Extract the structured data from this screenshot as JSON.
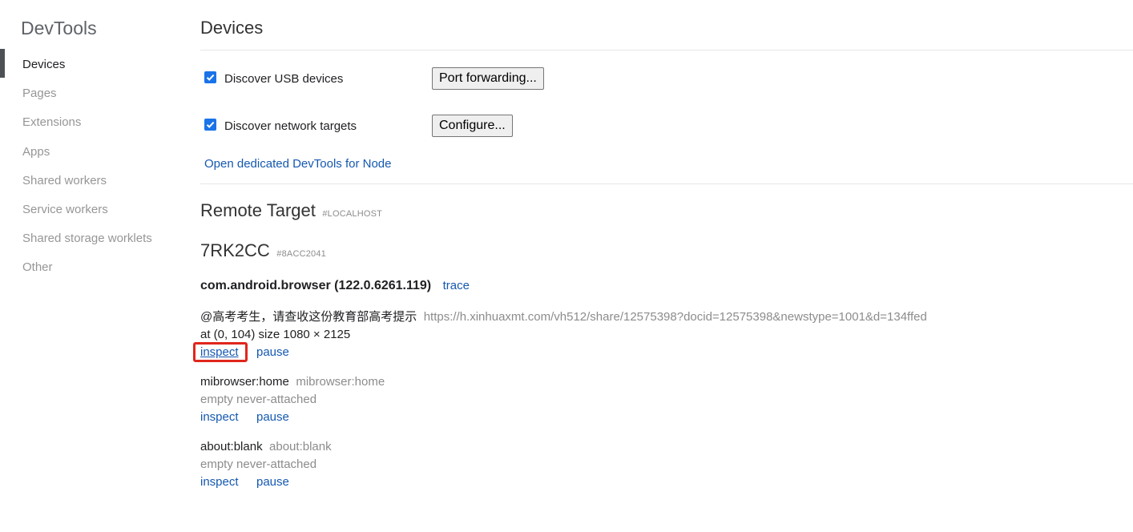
{
  "sidebar": {
    "title": "DevTools",
    "items": [
      {
        "label": "Devices",
        "active": true
      },
      {
        "label": "Pages",
        "active": false
      },
      {
        "label": "Extensions",
        "active": false
      },
      {
        "label": "Apps",
        "active": false
      },
      {
        "label": "Shared workers",
        "active": false
      },
      {
        "label": "Service workers",
        "active": false
      },
      {
        "label": "Shared storage worklets",
        "active": false
      },
      {
        "label": "Other",
        "active": false
      }
    ]
  },
  "main": {
    "title": "Devices",
    "discover_usb": {
      "label": "Discover USB devices",
      "checked": true
    },
    "port_forwarding_button": "Port forwarding...",
    "discover_network": {
      "label": "Discover network targets",
      "checked": true
    },
    "configure_button": "Configure...",
    "node_link": "Open dedicated DevTools for Node",
    "remote_target": {
      "title": "Remote Target",
      "id": "#LOCALHOST"
    },
    "device": {
      "name": "7RK2CC",
      "id": "#8ACC2041"
    },
    "browser": {
      "name": "com.android.browser (122.0.6261.119)",
      "trace_link": "trace"
    },
    "pages": [
      {
        "title": "@高考考生，请查收这份教育部高考提示",
        "url": "https://h.xinhuaxmt.com/vh512/share/12575398?docid=12575398&newstype=1001&d=134ffed",
        "info": "at (0, 104)  size 1080 × 2125",
        "inspect": "inspect",
        "pause": "pause",
        "highlighted": true
      },
      {
        "title": "mibrowser:home",
        "url": "mibrowser:home",
        "info": "empty never-attached",
        "inspect": "inspect",
        "pause": "pause",
        "highlighted": false
      },
      {
        "title": "about:blank",
        "url": "about:blank",
        "info": "empty never-attached",
        "inspect": "inspect",
        "pause": "pause",
        "highlighted": false
      }
    ]
  },
  "colors": {
    "link": "#1558b0",
    "checkbox": "#1a73e8",
    "highlight": "#e0261c",
    "active_indicator": "#4d5156"
  }
}
